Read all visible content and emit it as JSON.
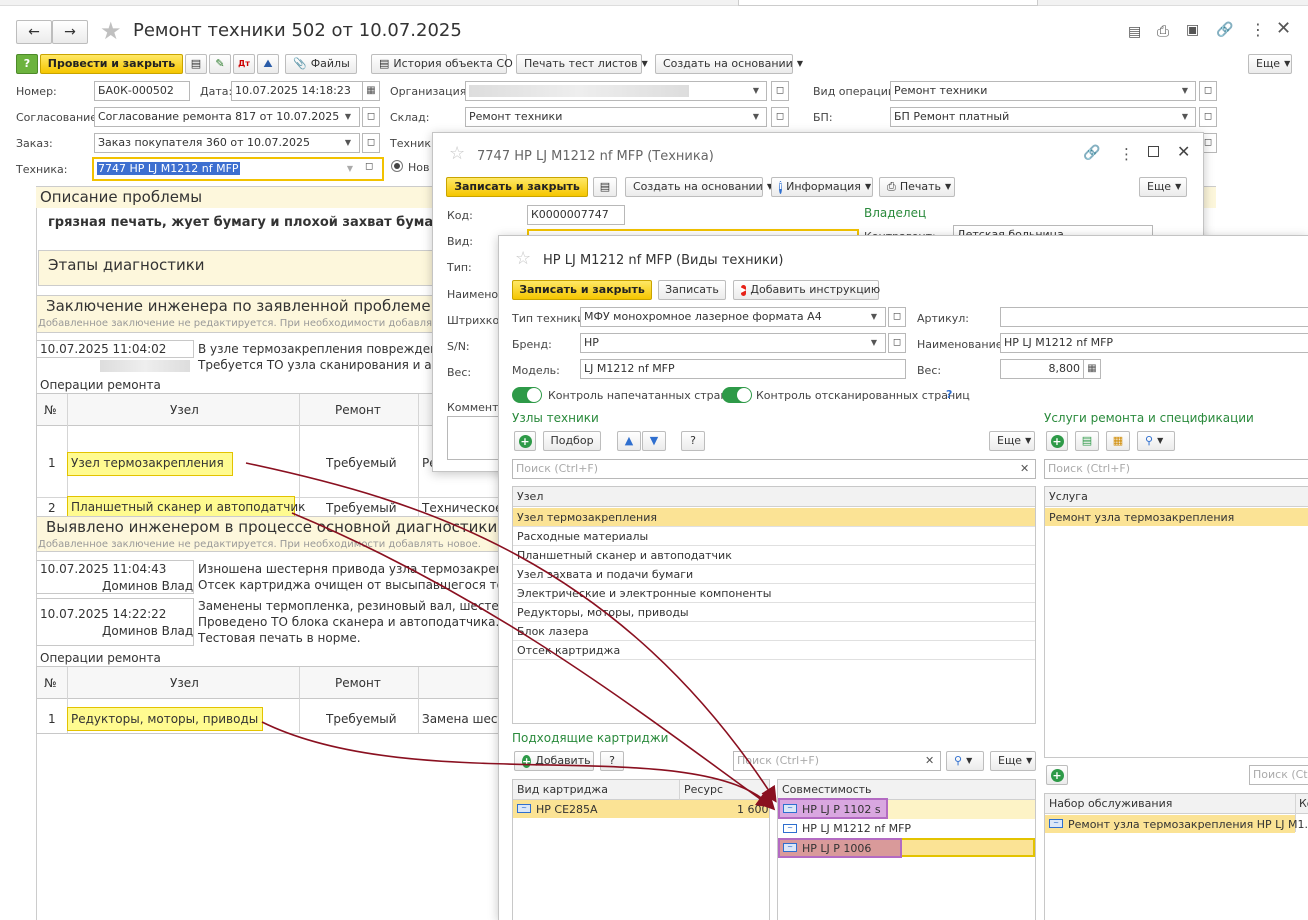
{
  "main": {
    "title": "Ремонт техники 502 от 10.07.2025",
    "toolbar": {
      "post_close": "Провести и закрыть",
      "files": "Файлы",
      "history": "История объекта СО",
      "print_test": "Печать тест листов",
      "create_based": "Создать на основании",
      "more": "Еще"
    },
    "fields": {
      "number_label": "Номер:",
      "number": "БА0К-000502",
      "date_label": "Дата:",
      "date": "10.07.2025 14:18:23",
      "org_label": "Организация:",
      "op_label": "Вид операции:",
      "op": "Ремонт техники",
      "agree_label": "Согласование:",
      "agree": "Согласование ремонта 817 от 10.07.2025",
      "warehouse_label": "Склад:",
      "warehouse": "Ремонт техники",
      "bp_label": "БП:",
      "bp": "БП Ремонт платный",
      "order_label": "Заказ:",
      "order": "Заказ покупателя 360 от 10.07.2025",
      "tech2_label": "Техник:",
      "tech_label": "Техника:",
      "tech": "7747 HP LJ M1212 nf MFP",
      "radio_new": "Нов"
    },
    "problem_title": "Описание проблемы",
    "problem_text": "грязная печать, жует бумагу и плохой захват бумаги с",
    "diag_title": "Этапы диагностики",
    "conclusion_title": "Заключение инженера по заявленной проблеме от кл",
    "note_text": "Добавленное заключение не редактируется. При необходимости добавлять",
    "note_text2": "Добавленное заключение не редактируется. При необходимости добавлять новое.",
    "entry1_date": "10.07.2025 11:04:02",
    "entry1_l1": "В узле термозакрепления поврежденны",
    "entry1_l2": "Требуется ТО узла сканирования и авт",
    "ops_title": "Операции ремонта",
    "col_num": "№",
    "col_node": "Узел",
    "col_repair": "Ремонт",
    "op1": {
      "n": "1",
      "node": "Узел термозакрепления",
      "repair": "Требуемый",
      "extra": "Ре"
    },
    "op2": {
      "n": "2",
      "node": "Планшетный сканер и автоподатчик",
      "repair": "Требуемый",
      "extra": "Техническое"
    },
    "found_title": "Выявлено инженером в процессе основной диагностики.",
    "entry2_date": "10.07.2025 11:04:43",
    "entry2_author": "Доминов Влад",
    "entry2_l1": "Изношена шестерня привода узла термозакрепл",
    "entry2_l2": "Отсек картриджа очищен от высыпавшегося тоне",
    "entry3_date": "10.07.2025 14:22:22",
    "entry3_author": "Доминов Влад",
    "entry3_l1": "Заменены термопленка, резиновый вал, шестерня",
    "entry3_l2": "Проведено ТО блока сканера и автоподатчика. Об",
    "entry3_l3": "Тестовая печать в норме.",
    "ops2_title": "Операции ремонта",
    "op3": {
      "n": "1",
      "node": "Редукторы, моторы, приводы",
      "repair": "Требуемый",
      "extra": "Замена шест"
    }
  },
  "win1": {
    "title": "7747 HP LJ M1212 nf MFP (Техника)",
    "save_close": "Записать и закрыть",
    "create_based": "Создать на основании",
    "info": "Информация",
    "print": "Печать",
    "more": "Еще",
    "code_label": "Код:",
    "code": "К0000007747",
    "owner_title": "Владелец",
    "contractor_label": "Контрагент:",
    "contractor": "Детская больница",
    "type_label": "Вид:",
    "tip_label": "Тип:",
    "name_label": "Наименова",
    "barcode_label": "Штрихкод:",
    "sn_label": "S/N:",
    "weight_label": "Вес:",
    "comment_label": "Комментар"
  },
  "win2": {
    "title": "HP LJ M1212 nf MFP (Виды техники)",
    "save_close": "Записать и закрыть",
    "save": "Записать",
    "add_instruction": "Добавить инструкцию",
    "type_label": "Тип техники:",
    "type": "МФУ монохромное лазерное формата А4",
    "article_label": "Артикул:",
    "brand_label": "Бренд:",
    "brand": "HP",
    "name_label": "Наименование:",
    "name": "HP LJ M1212 nf MFP",
    "model_label": "Модель:",
    "model": "LJ M1212 nf MFP",
    "weight_label": "Вес:",
    "weight": "8,800",
    "toggle1": "Контроль напечатанных страниц",
    "toggle2": "Контроль отсканированных страниц",
    "help": "?",
    "nodes_title": "Узлы техники",
    "pick": "Подбор",
    "more": "Еще",
    "search_ph": "Поиск (Ctrl+F)",
    "nodes_col": "Узел",
    "nodes": [
      "Узел термозакрепления",
      "Расходные материалы",
      "Планшетный сканер и автоподатчик",
      "Узел захвата и подачи бумаги",
      "Электрические и электронные компоненты",
      "Редукторы, моторы, приводы",
      "Блок лазера",
      "Отсек картриджа"
    ],
    "services_title": "Услуги ремонта и спецификации",
    "service_col": "Услуга",
    "services": [
      "Ремонт узла термозакрепления"
    ],
    "cart_title": "Подходящие картриджи",
    "add": "Добавить",
    "cart_col1": "Вид картриджа",
    "cart_col2": "Ресурс",
    "cart_name": "HP CE285A",
    "cart_res": "1 600",
    "compat_col": "Совместимость",
    "compat": [
      "HP LJ P 1102 s",
      "HP LJ M1212 nf MFP",
      "HP LJ P 1006"
    ],
    "kit_col": "Набор обслуживания",
    "kit_col2": "Ко",
    "kit": "Ремонт узла термозакрепления HP LJ M1..."
  }
}
